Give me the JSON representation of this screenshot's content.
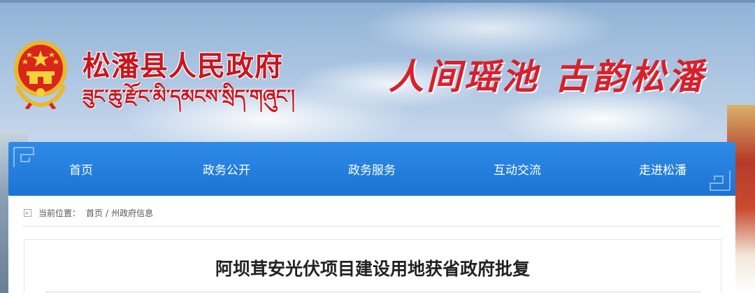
{
  "header": {
    "site_title": "松潘县人民政府",
    "site_title_tibetan": "ཟུང་ཆུ་རྫོང་མི་དམངས་སྲིད་གཞུང་།",
    "slogan": "人间瑶池 古韵松潘",
    "emblem_icon": "national-emblem-icon"
  },
  "nav": {
    "items": [
      {
        "label": "首页"
      },
      {
        "label": "政务公开"
      },
      {
        "label": "政务服务"
      },
      {
        "label": "互动交流"
      },
      {
        "label": "走进松潘"
      }
    ]
  },
  "breadcrumb": {
    "prefix": "当前位置：",
    "items": [
      "首页",
      "州政府信息"
    ],
    "separator": "/"
  },
  "article": {
    "title": "阿坝茸安光伏项目建设用地获省政府批复"
  },
  "colors": {
    "brand_red": "#c8161d",
    "nav_blue": "#1c73d3"
  }
}
